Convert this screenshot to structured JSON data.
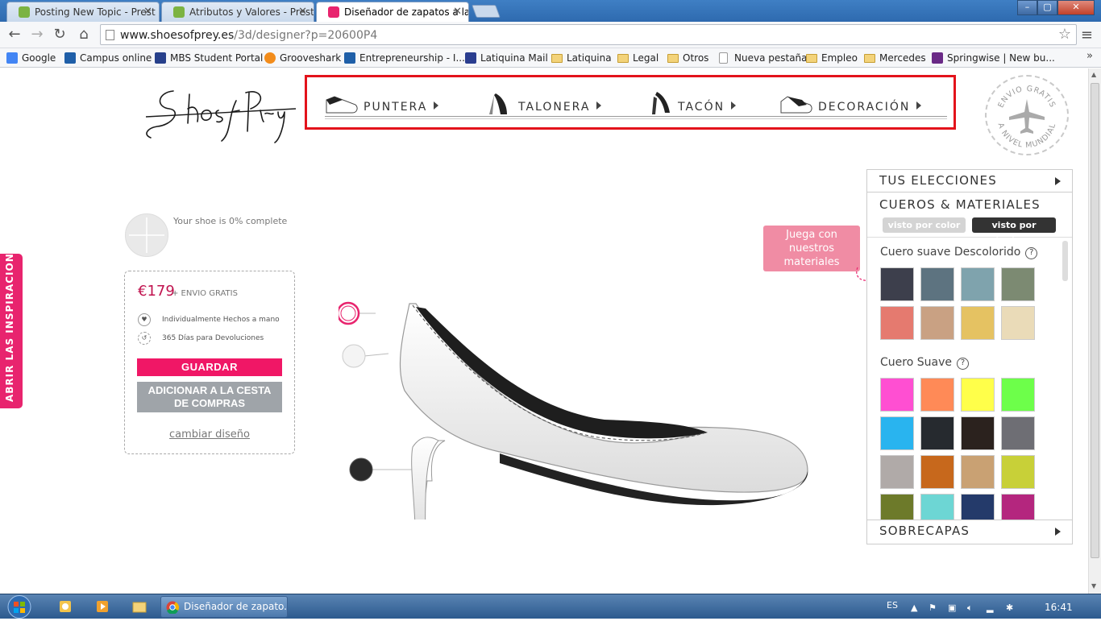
{
  "browser": {
    "tabs": [
      {
        "title": "Posting New Topic - Prest",
        "active": false
      },
      {
        "title": "Atributos y Valores - Prest",
        "active": false
      },
      {
        "title": "Diseñador de zapatos a la",
        "active": true
      }
    ],
    "url_host": "www.shoesofprey.es",
    "url_path": "/3d/designer?p=20600P4",
    "bookmarks": [
      {
        "label": "Google",
        "icon": "google-icon"
      },
      {
        "label": "Campus online",
        "icon": "ie-icon"
      },
      {
        "label": "MBS Student Portal",
        "icon": "mbs-icon"
      },
      {
        "label": "Grooveshark",
        "icon": "grooveshark-icon"
      },
      {
        "label": "Entrepreneurship - I...",
        "icon": "ie-icon"
      },
      {
        "label": "Latiquina Mail",
        "icon": "mail-icon"
      },
      {
        "label": "Latiquina",
        "icon": "folder-icon"
      },
      {
        "label": "Legal",
        "icon": "folder-icon"
      },
      {
        "label": "Otros",
        "icon": "folder-icon"
      },
      {
        "label": "Nueva pestaña",
        "icon": "page-icon"
      },
      {
        "label": "Empleo",
        "icon": "folder-icon"
      },
      {
        "label": "Mercedes",
        "icon": "folder-icon"
      },
      {
        "label": "Springwise | New bu...",
        "icon": "springwise-icon"
      }
    ],
    "bookmarks_more": "»"
  },
  "site": {
    "logo_text": "Shoes of Prey",
    "nav": [
      {
        "label": "PUNTERA"
      },
      {
        "label": "TALONERA"
      },
      {
        "label": "TACÓN"
      },
      {
        "label": "DECORACIÓN"
      }
    ],
    "stamp_top": "ENVIO GRATIS",
    "stamp_bottom": "A NIVEL MUNDIAL",
    "inspo_tab": "ABRIR LAS INSPIRACIONES ▸",
    "progress_text": "Your shoe is 0% complete",
    "progress_fraction": 0,
    "price": "€179",
    "price_extra": "+ ENVIO GRATIS",
    "feature_1": "Individualmente Hechos a mano",
    "feature_2": "365 Días para Devoluciones",
    "save_button": "GUARDAR",
    "cart_button_line1": "ADICIONAR A LA CESTA",
    "cart_button_line2": "DE COMPRAS",
    "change_link": "cambiar diseño",
    "tooltip": "Juega con nuestros materiales"
  },
  "panel": {
    "your_choices": "TUS ELECCIONES",
    "materials_title": "CUEROS & MATERIALES",
    "view_by_color": "visto por color",
    "view_by_texture": "visto por textura",
    "groups": [
      {
        "title": "Cuero suave Descolorido",
        "swatches": [
          "#3d3f4c",
          "#5d7380",
          "#7fa3ad",
          "#7c8a72",
          "#e57a6f",
          "#c9a183",
          "#e5c262",
          "#eadbb8"
        ]
      },
      {
        "title": "Cuero Suave",
        "swatches": [
          "#ff4fd2",
          "#ff8a57",
          "#ffff4a",
          "#6dff4a",
          "#29b4ef",
          "#262a2f",
          "#2b221e",
          "#6e6e74",
          "#b0aaa8",
          "#c7681c",
          "#c9a173",
          "#c8d038",
          "#6d7a2a",
          "#6dd6d4",
          "#243a6a",
          "#b4267e"
        ]
      }
    ],
    "overlays": "SOBRECAPAS"
  },
  "taskbar": {
    "chrome_window": "Diseñador de zapato...",
    "lang": "ES",
    "clock": "16:41"
  },
  "colors": {
    "brand_pink": "#f01766",
    "highlight_red": "#e3131b",
    "tooltip_pink": "#f08ca4",
    "inspo_pink": "#e8246e"
  }
}
